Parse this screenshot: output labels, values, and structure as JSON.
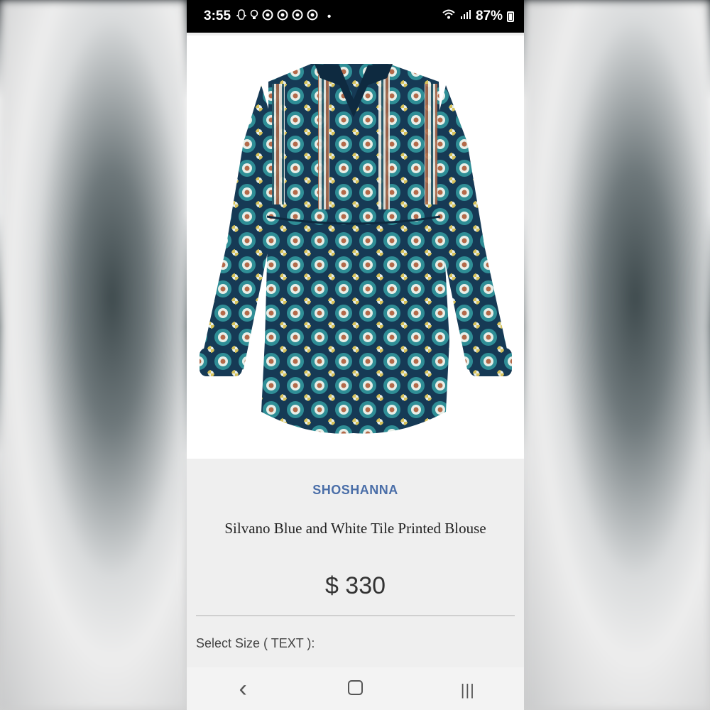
{
  "status_bar": {
    "time": "3:55",
    "battery": "87%",
    "notification_icons": [
      "snapchat-icon",
      "lightbulb-icon",
      "chrome-icon",
      "chrome-icon",
      "chrome-icon",
      "chrome-icon"
    ],
    "dot": "•"
  },
  "product": {
    "image_alt": "Blue and white tile printed blouse",
    "brand": "SHOSHANNA",
    "title": "Silvano Blue and White Tile Printed Blouse",
    "price": "$ 330",
    "size_label": "Select Size ( TEXT ):"
  },
  "nav": {
    "back": "‹",
    "recents": "|||"
  },
  "colors": {
    "brand_color": "#4a6ea8",
    "blouse_navy": "#163a55",
    "blouse_teal": "#2f8e96",
    "blouse_rust": "#b36a4a"
  }
}
